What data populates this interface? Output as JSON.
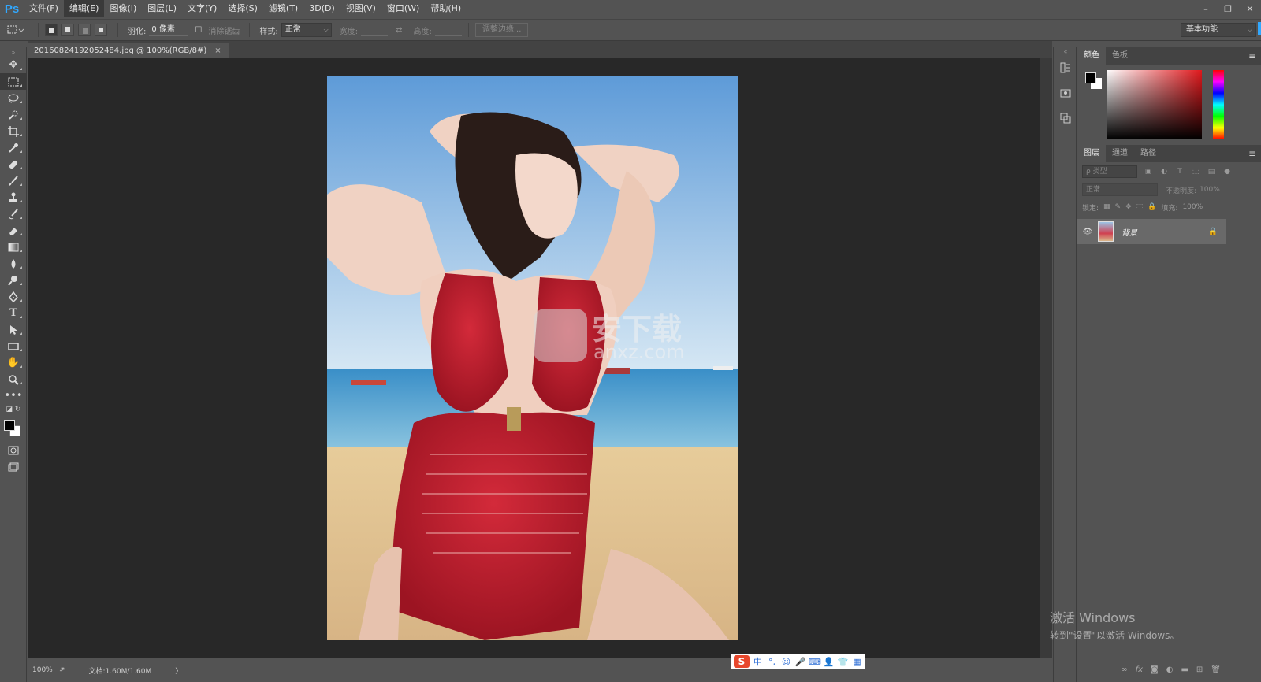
{
  "app": {
    "logo": "Ps"
  },
  "menu": [
    "文件(F)",
    "编辑(E)",
    "图像(I)",
    "图层(L)",
    "文字(Y)",
    "选择(S)",
    "滤镜(T)",
    "3D(D)",
    "视图(V)",
    "窗口(W)",
    "帮助(H)"
  ],
  "window_controls": {
    "minimize": "–",
    "restore": "❐",
    "close": "✕"
  },
  "options": {
    "feather_label": "羽化:",
    "feather_value": "0 像素",
    "antialias_label": "消除锯齿",
    "style_label": "样式:",
    "style_value": "正常",
    "width_label": "宽度:",
    "height_label": "高度:",
    "refine_edge": "调整边缘..."
  },
  "workspace": "基本功能",
  "document": {
    "tab_title": "20160824192052484.jpg @ 100%(RGB/8#)",
    "close": "×"
  },
  "watermark": {
    "main": "安下载",
    "sub": "anxz.com"
  },
  "status": {
    "zoom": "100%",
    "doc_size": "文档:1.60M/1.60M",
    "arrow": "〉"
  },
  "ime": {
    "logo": "S",
    "lang": "中",
    "punct": "°,",
    "emoji": "☺",
    "mic": "🎤",
    "keyboard": "⌨",
    "user": "👤",
    "shirt": "👕",
    "grid": "▦"
  },
  "color_panel": {
    "tabs": [
      "颜色",
      "色板"
    ]
  },
  "layers_panel": {
    "tabs": [
      "图层",
      "通道",
      "路径"
    ],
    "filter_placeholder": "ρ 类型",
    "blend_mode": "正常",
    "opacity_label": "不透明度:",
    "opacity_value": "100%",
    "lock_label": "锁定:",
    "fill_label": "填充:",
    "fill_value": "100%",
    "layers": [
      {
        "name": "背景",
        "visible": true,
        "locked": true
      }
    ]
  },
  "activation": {
    "line1": "激活 Windows",
    "line2": "转到\"设置\"以激活 Windows。"
  }
}
